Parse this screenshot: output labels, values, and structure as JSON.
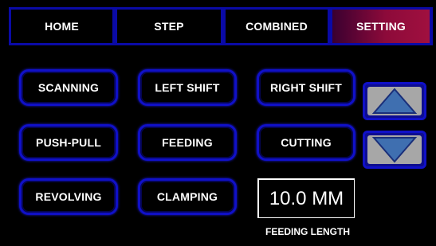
{
  "tabs": [
    {
      "label": "HOME"
    },
    {
      "label": "STEP"
    },
    {
      "label": "COMBINED"
    },
    {
      "label": "SETTING",
      "active": true
    }
  ],
  "buttons": {
    "scanning": "SCANNING",
    "left_shift": "LEFT SHIFT",
    "right_shift": "RIGHT SHIFT",
    "push_pull": "PUSH-PULL",
    "feeding": "FEEDING",
    "cutting": "CUTTING",
    "revolving": "REVOLVING",
    "clamping": "CLAMPING"
  },
  "feeding_length": {
    "value": "10.0 MM",
    "label": "FEEDING LENGTH"
  },
  "icons": {
    "up": "up-arrow-icon",
    "down": "down-arrow-icon"
  },
  "colors": {
    "background": "#000000",
    "border_blue": "#1010c8",
    "active_tab": "#8d0a3a",
    "arrow_fill": "#3f6fb0",
    "arrow_bg": "#a7a7a7"
  }
}
